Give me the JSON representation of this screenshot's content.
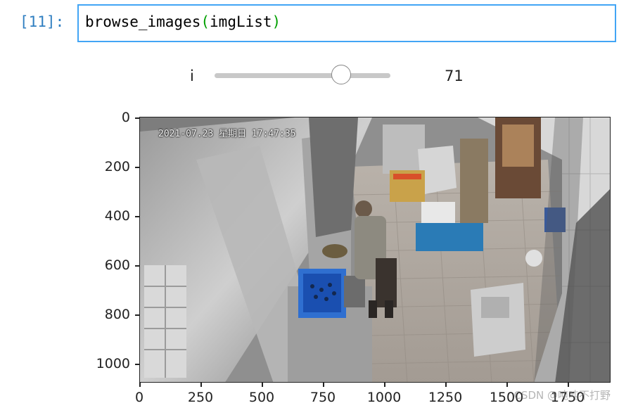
{
  "cell": {
    "prompt": "[11]:",
    "code_fn": "browse_images",
    "code_open": "(",
    "code_arg": "imgList",
    "code_close": ")"
  },
  "slider": {
    "label": "i",
    "value": "71",
    "fraction": 0.72
  },
  "plot": {
    "y_ticks": [
      "0",
      "200",
      "400",
      "600",
      "800",
      "1000"
    ],
    "x_ticks": [
      "0",
      "250",
      "500",
      "750",
      "1000",
      "1250",
      "1500",
      "1750"
    ],
    "overlay_text": "2021-07.23 星期日 17:47:35"
  },
  "watermark": "CSDN @吨吨不打野"
}
